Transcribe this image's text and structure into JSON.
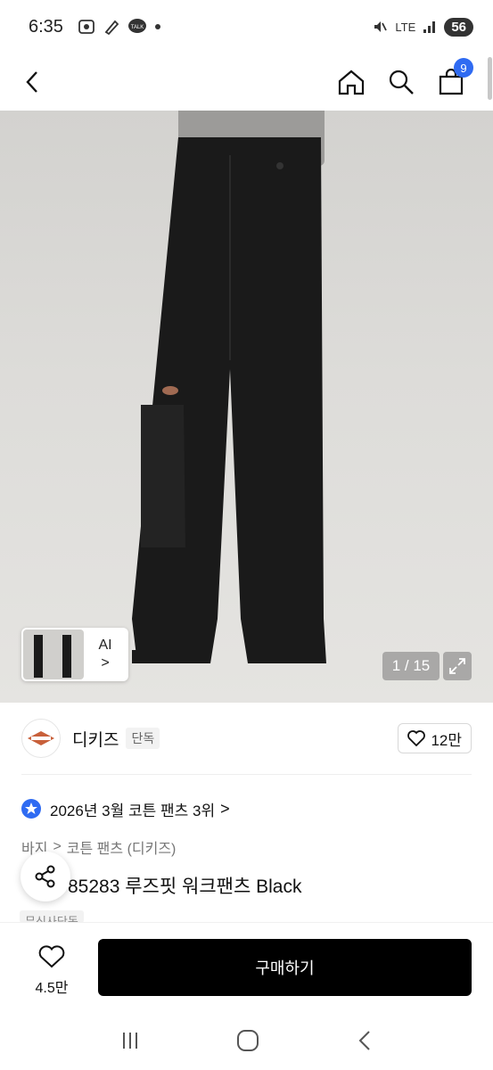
{
  "status_bar": {
    "time": "6:35",
    "network": "LTE",
    "battery": "56"
  },
  "nav": {
    "cart_count": "9"
  },
  "gallery": {
    "counter": "1 / 15",
    "ai_label": "AI",
    "ai_chevron": ">"
  },
  "brand": {
    "name": "디키즈",
    "tag": "단독",
    "likes": "12만"
  },
  "ranking": {
    "text": "2026년 3월 코튼 팬츠 3위",
    "chevron": ">"
  },
  "breadcrumb": {
    "items": [
      "바지",
      ">",
      "코튼 팬츠 (디키즈)"
    ]
  },
  "product": {
    "title_visible": "85283 루즈핏 워크팬츠 Black",
    "title_prefix_partial": "디키즈",
    "tag": "무신사단독"
  },
  "bottom": {
    "wishlist_count": "4.5만",
    "buy_label": "구매하기"
  },
  "colors": {
    "accent_blue": "#2f6bf2",
    "buy_button": "#000000",
    "pants": "#1a1a1a"
  }
}
